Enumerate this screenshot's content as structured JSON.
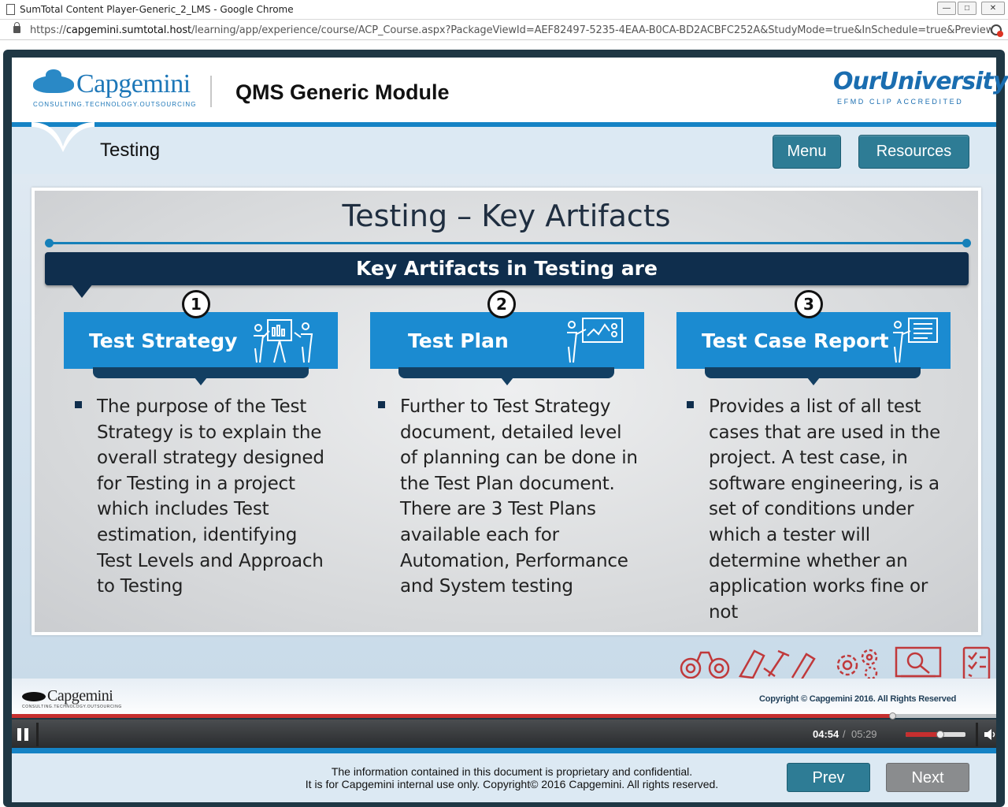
{
  "browser": {
    "window_title": "SumTotal Content Player-Generic_2_LMS - Google Chrome",
    "url_prefix": "https://",
    "url_host": "capgemini.sumtotal.host",
    "url_path": "/learning/app/experience/course/ACP_Course.aspx?PackageViewId=AEF82497-5235-4EAA-B0CA-BD2ACBFC252A&StudyMode=true&InSchedule=true&Preview..."
  },
  "header": {
    "logo_brand": "Capgemini",
    "logo_tagline": "CONSULTING.TECHNOLOGY.OUTSOURCING",
    "module_title": "QMS Generic Module",
    "partner_logo": "OurUniversity",
    "partner_sub": "EFMD CLIP ACCREDITED"
  },
  "subheader": {
    "section_title": "Testing",
    "menu_label": "Menu",
    "resources_label": "Resources"
  },
  "slide": {
    "title": "Testing – Key Artifacts",
    "banner": "Key Artifacts in Testing are",
    "cards": [
      {
        "number": "1",
        "title": "Test Strategy",
        "icon": "presentation-board-icon",
        "lines": [
          "The purpose of the Test",
          "Strategy is to explain the",
          "overall strategy designed",
          "for Testing in a project",
          "which includes Test",
          "estimation, identifying",
          "Test Levels and Approach",
          "to Testing"
        ]
      },
      {
        "number": "2",
        "title": "Test Plan",
        "icon": "chart-presenter-icon",
        "lines": [
          "Further to Test Strategy",
          "document, detailed level",
          "of planning can be done in",
          "the Test Plan document.",
          "There are 3 Test Plans",
          "available each for",
          "Automation, Performance",
          "and System testing"
        ]
      },
      {
        "number": "3",
        "title": "Test Case Report",
        "icon": "document-presenter-icon",
        "lines": [
          "Provides a list of all test",
          "cases that are used in the",
          "project. A test case, in",
          "software engineering, is a",
          "set of conditions under",
          "which a tester will",
          "determine whether an",
          "application works fine or",
          "not"
        ]
      }
    ]
  },
  "footer": {
    "logo_brand": "Capgemini",
    "logo_tagline": "CONSULTING.TECHNOLOGY.OUTSOURCING",
    "copyright": "Copyright © Capgemini 2016. All Rights Reserved",
    "decor_icons": [
      "binoculars-icon",
      "tools-icon",
      "gears-icon",
      "magnifier-monitor-icon",
      "checklist-icon"
    ]
  },
  "player": {
    "progress": 0.895,
    "time_current": "04:54",
    "time_separator": "/",
    "time_total": "05:29",
    "volume": 0.58,
    "colors": {
      "progress": "#c62f2f",
      "accent": "#1583c5",
      "button": "#2e7c95"
    }
  },
  "nav": {
    "disclaimer_line1": "The information contained in this document is proprietary and confidential.",
    "disclaimer_line2": "It is for Capgemini internal use only. Copyright© 2016 Capgemini. All rights reserved.",
    "prev_label": "Prev",
    "next_label": "Next"
  }
}
